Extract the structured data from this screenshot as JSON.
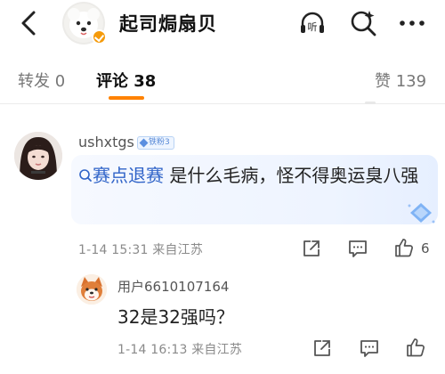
{
  "header": {
    "back_icon": "chevron-left-icon",
    "title": "起司焗扇贝",
    "verified_badge": "orange-check-badge",
    "icons": [
      "listen-icon",
      "super-search-icon",
      "more-icon"
    ],
    "listen_label": "听"
  },
  "tabs": [
    {
      "label": "转发",
      "count": "0"
    },
    {
      "label": "评论",
      "count": "38"
    },
    {
      "label": "赞",
      "count": "139"
    }
  ],
  "active_tab": "评论",
  "accent_color": "#ff8200",
  "link_color": "#2f63c8",
  "comment": {
    "username": "ushxtgs",
    "fan_badge": "铁粉3",
    "topic": "赛点退赛",
    "text_after": " 是什么毛病，怪不得奥运臭八强",
    "time": "1-14 15:31",
    "location": "来自江苏",
    "likes": "6",
    "actions": [
      "share-icon",
      "comment-icon",
      "like-icon"
    ]
  },
  "reply": {
    "username": "用户6610107164",
    "text": "32是32强吗？",
    "time": "1-14 16:13",
    "location": "来自江苏",
    "actions": [
      "share-icon",
      "comment-icon",
      "like-icon"
    ]
  }
}
